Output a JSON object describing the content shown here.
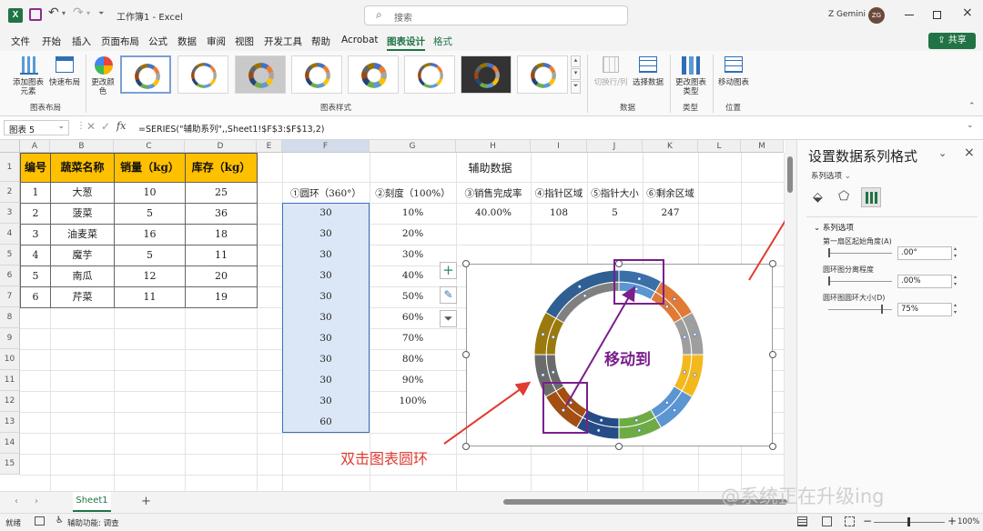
{
  "titlebar": {
    "title": "工作簿1 - Excel",
    "search_placeholder": "搜索",
    "user_name": "Z Gemini",
    "user_initials": "ZG"
  },
  "menu": {
    "tabs": [
      "文件",
      "开始",
      "插入",
      "页面布局",
      "公式",
      "数据",
      "审阅",
      "视图",
      "开发工具",
      "帮助",
      "Acrobat",
      "图表设计",
      "格式"
    ],
    "share_label": "共享"
  },
  "ribbon": {
    "add_chart_element": "添加图表元素",
    "quick_layout": "快速布局",
    "change_colors": "更改颜色",
    "switch_row_col": "切换行/列",
    "select_data": "选择数据",
    "change_chart_type": "更改图表类型",
    "move_chart": "移动图表",
    "group_layout": "图表布局",
    "group_styles": "图表样式",
    "group_data": "数据",
    "group_type": "类型",
    "group_location": "位置"
  },
  "formula_bar": {
    "name_box": "图表 5",
    "fx": "fx",
    "formula": "=SERIES(\"辅助系列\",,Sheet1!$F$3:$F$13,2)"
  },
  "grid": {
    "columns": [
      "A",
      "B",
      "C",
      "D",
      "E",
      "F",
      "G",
      "H",
      "I",
      "J",
      "K",
      "L",
      "M"
    ],
    "rows": [
      "1",
      "2",
      "3",
      "4",
      "5",
      "6",
      "7",
      "8",
      "9",
      "10",
      "11",
      "12",
      "13",
      "14",
      "15"
    ]
  },
  "veg_table": {
    "headers": [
      "编号",
      "蔬菜名称",
      "销量（kg）",
      "库存（kg）"
    ],
    "rows": [
      [
        "1",
        "大葱",
        "10",
        "25"
      ],
      [
        "2",
        "菠菜",
        "5",
        "36"
      ],
      [
        "3",
        "油麦菜",
        "16",
        "18"
      ],
      [
        "4",
        "魔芋",
        "5",
        "11"
      ],
      [
        "5",
        "南瓜",
        "12",
        "20"
      ],
      [
        "6",
        "芹菜",
        "11",
        "19"
      ]
    ]
  },
  "aux": {
    "title": "辅助数据",
    "headers": [
      "①圆环（360°）",
      "②刻度（100%）",
      "③销售完成率",
      "④指针区域",
      "⑤指针大小",
      "⑥剩余区域"
    ],
    "f_values": [
      "30",
      "30",
      "30",
      "30",
      "30",
      "30",
      "30",
      "30",
      "30",
      "30",
      "60"
    ],
    "g_values": [
      "10%",
      "20%",
      "30%",
      "40%",
      "50%",
      "60%",
      "70%",
      "80%",
      "90%",
      "100%"
    ],
    "row3": [
      "40.00%",
      "108",
      "5",
      "247"
    ]
  },
  "annotations": {
    "move_to": "移动到",
    "double_click": "双击图表圆环"
  },
  "panel": {
    "title": "设置数据系列格式",
    "series_dropdown": "系列选项",
    "section": "系列选项",
    "first_slice_angle": "第一扇区起始角度(A)",
    "first_slice_value": ".00°",
    "explosion": "圆环图分离程度",
    "explosion_value": ".00%",
    "hole_size": "圆环图圆环大小(D)",
    "hole_size_value": "75%"
  },
  "sheets": {
    "tab": "Sheet1",
    "add": "+"
  },
  "status": {
    "ready": "就绪",
    "accessibility": "辅助功能: 调查",
    "zoom": "100%"
  },
  "watermark": "@系统正在升级ing",
  "colors": {
    "excel_green": "#217346",
    "header_fill": "#ffc000",
    "annotation_red": "#e03c31",
    "annotation_purple": "#7a1f8c",
    "selection_blue": "#dbe7f7"
  },
  "chart_data": {
    "type": "donut",
    "note_series": "辅助系列",
    "outer_ring_values": [
      30,
      30,
      30,
      30,
      30,
      30,
      30,
      30,
      30,
      30,
      60
    ],
    "hole_size_percent": 75,
    "first_slice_angle_deg": 0
  }
}
